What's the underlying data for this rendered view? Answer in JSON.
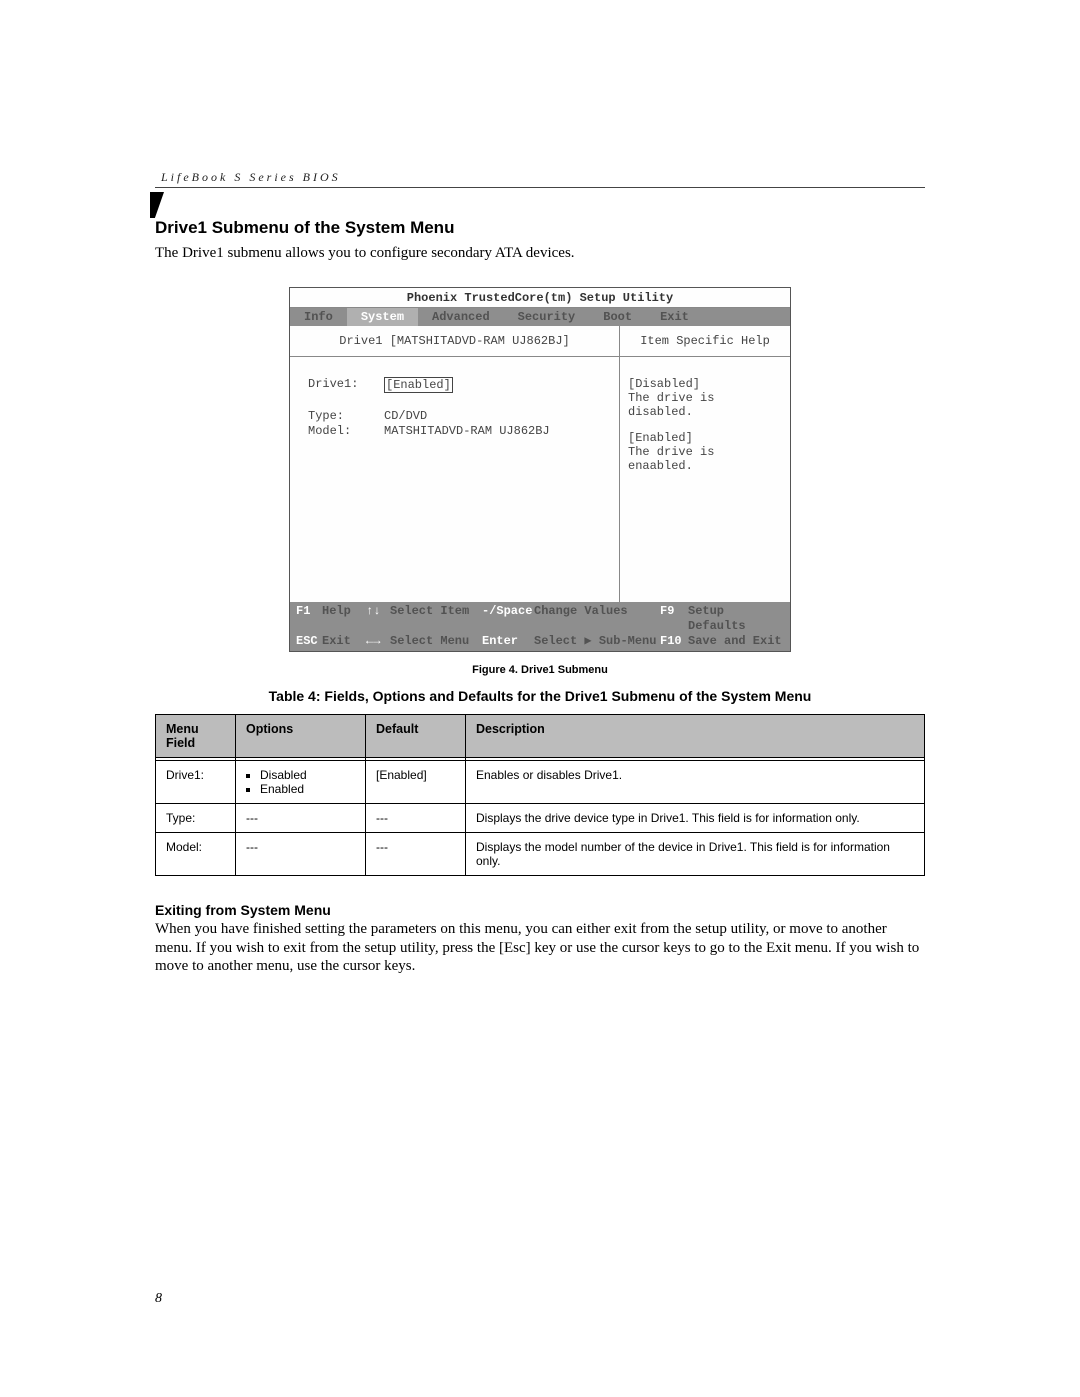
{
  "header": {
    "running": "LifeBook S Series BIOS"
  },
  "section": {
    "title": "Drive1 Submenu of the System Menu",
    "intro": "The Drive1 submenu allows you to configure secondary ATA devices."
  },
  "bios": {
    "title": "Phoenix TrustedCore(tm) Setup Utility",
    "tabs": [
      "Info",
      "System",
      "Advanced",
      "Security",
      "Boot",
      "Exit"
    ],
    "activeTab": "System",
    "left_head": "Drive1 [MATSHITADVD-RAM UJ862BJ]",
    "right_head": "Item Specific Help",
    "fields": {
      "drive_label": "Drive1:",
      "drive_value": "[Enabled]",
      "type_label": "Type:",
      "type_value": "CD/DVD",
      "model_label": "Model:",
      "model_value": "MATSHITADVD-RAM UJ862BJ"
    },
    "help": {
      "disabled_head": "[Disabled]",
      "disabled_text": "The drive is disabled.",
      "enabled_head": "[Enabled]",
      "enabled_text": "The drive is enaabled."
    },
    "footer": {
      "f1": "F1",
      "f1l": "Help",
      "ud": "↑↓",
      "udl": "Select Item",
      "ms": "-/Space",
      "msl": "Change Values",
      "f9": "F9",
      "f9l": "Setup Defaults",
      "esc": "ESC",
      "escl": "Exit",
      "lr": "←→",
      "lrl": "Select Menu",
      "ent": "Enter",
      "entl": "Select ▶ Sub-Menu",
      "f10": "F10",
      "f10l": "Save and Exit"
    }
  },
  "figure_caption": "Figure 4.  Drive1 Submenu",
  "table_caption": "Table 4: Fields, Options and Defaults for the Drive1 Submenu of the System Menu",
  "table": {
    "headers": [
      "Menu Field",
      "Options",
      "Default",
      "Description"
    ],
    "rows": [
      {
        "field": "Drive1:",
        "options": [
          "Disabled",
          "Enabled"
        ],
        "default": "[Enabled]",
        "desc": "Enables or disables Drive1."
      },
      {
        "field": "Type:",
        "options_text": "---",
        "default": "---",
        "desc": "Displays the drive device type in Drive1. This field is for information only."
      },
      {
        "field": "Model:",
        "options_text": "---",
        "default": "---",
        "desc": "Displays the model number of the device in Drive1. This field is for information only."
      }
    ]
  },
  "exiting": {
    "heading": "Exiting from System Menu",
    "text": "When you have finished setting the parameters on this menu, you can either exit from the setup utility, or move to another menu. If you wish to exit from the setup utility, press the [Esc] key or use the cursor keys to go to the Exit menu. If you wish to move to another menu, use the cursor keys."
  },
  "page_number": "8",
  "chart_data": {
    "type": "table",
    "title": "Fields, Options and Defaults for the Drive1 Submenu of the System Menu",
    "columns": [
      "Menu Field",
      "Options",
      "Default",
      "Description"
    ],
    "rows": [
      [
        "Drive1:",
        "Disabled; Enabled",
        "[Enabled]",
        "Enables or disables Drive1."
      ],
      [
        "Type:",
        "---",
        "---",
        "Displays the drive device type in Drive1. This field is for information only."
      ],
      [
        "Model:",
        "---",
        "---",
        "Displays the model number of the device in Drive1. This field is for information only."
      ]
    ]
  }
}
